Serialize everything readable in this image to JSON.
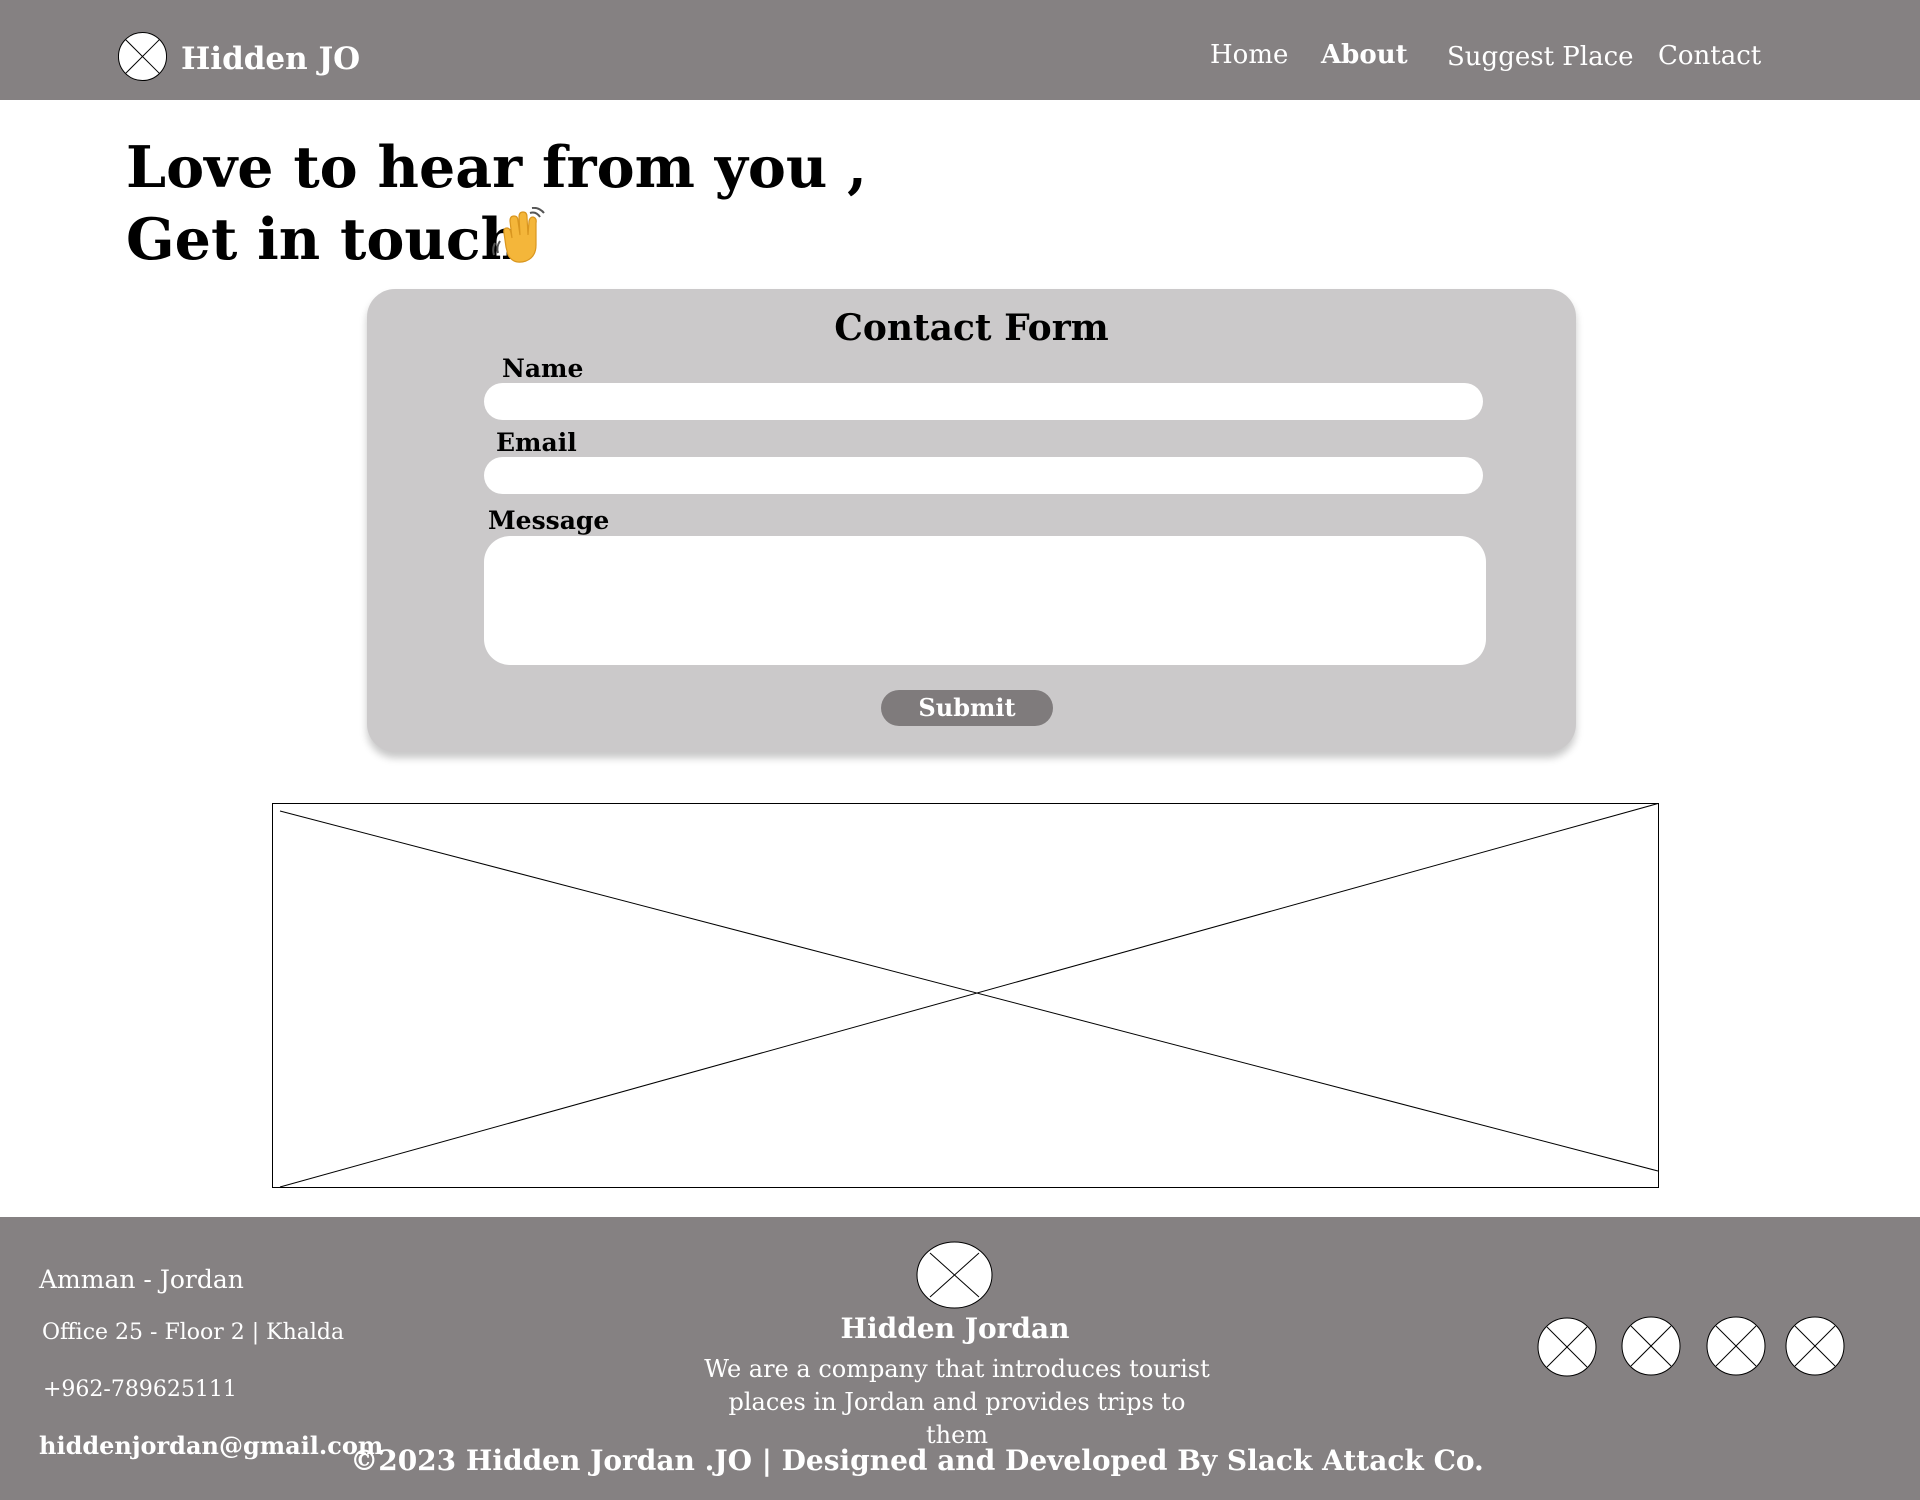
{
  "header": {
    "brand": "Hidden JO",
    "nav": {
      "home": "Home",
      "about": "About",
      "suggest_place": "Suggest Place",
      "contact": "Contact"
    }
  },
  "hero": {
    "line1": "Love to hear from you ,",
    "line2": "Get in touch",
    "emoji_icon": "waving-hand-icon"
  },
  "contact_form": {
    "title": "Contact Form",
    "name_label": "Name",
    "name_value": "",
    "email_label": "Email",
    "email_value": "",
    "message_label": "Message",
    "message_value": "",
    "submit_label": "Submit"
  },
  "footer": {
    "city": "Amman - Jordan",
    "office": "Office 25 - Floor 2 | Khalda",
    "phone": "+962-789625111",
    "email": "hiddenjordan@gmail.com",
    "brand": "Hidden Jordan",
    "description": "We are a company that introduces tourist places in Jordan and provides trips to them",
    "copyright": "©2023 Hidden Jordan .JO | Designed and Developed By Slack Attack Co.",
    "social_icons": [
      "social-icon-1",
      "social-icon-2",
      "social-icon-3",
      "social-icon-4"
    ]
  },
  "colors": {
    "header_bg": "#858182",
    "footer_bg": "#858182",
    "form_bg": "#cbc9ca",
    "button_bg": "#7f7b7c",
    "text_light": "#ffffff"
  }
}
